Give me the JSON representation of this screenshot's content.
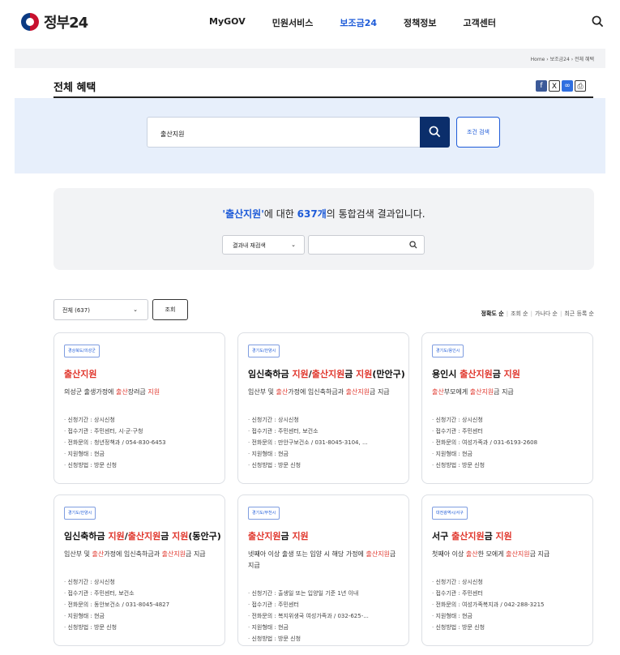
{
  "header": {
    "logo_text": "정부24",
    "nav": [
      "MyGOV",
      "민원서비스",
      "보조금24",
      "정책정보",
      "고객센터"
    ],
    "active_nav": "보조금24",
    "search_icon": "search-icon"
  },
  "breadcrumb": "Home  ›  보조금24  ›  전체 혜택",
  "page_title": "전체 혜택",
  "share_icons": [
    "facebook-icon",
    "x-icon",
    "link-icon",
    "print-icon"
  ],
  "search": {
    "query": "출산지원",
    "button_icon": "search-icon",
    "condition_button": "조건 검색"
  },
  "result": {
    "keyword": "'출산지원'",
    "count": "637개",
    "text_mid": "에 대한 ",
    "text_end": "의 통합검색 결과입니다.",
    "within_label": "결과내 재검색",
    "within_placeholder": ""
  },
  "filter": {
    "selected": "전체 (637)",
    "query_button": "조회"
  },
  "sort": [
    "정확도 순",
    "조회 순",
    "가나다 순",
    "최근 등록 순"
  ],
  "sort_active": "정확도 순",
  "cards": [
    {
      "tag": "경상북도/의성군",
      "title_parts": [
        {
          "t": "출산지원",
          "r": true
        }
      ],
      "desc_parts": [
        {
          "t": "의성군 출생가정에 ",
          "r": false
        },
        {
          "t": "출산",
          "r": true
        },
        {
          "t": "장려금 ",
          "r": false
        },
        {
          "t": "지원",
          "r": true
        }
      ],
      "items": [
        "신청기간 : 상시신청",
        "접수기관 : 주민센터, 시·군·구청",
        "전화문의 : 청년정책과 / 054-830-6453",
        "지원형태 : 현금",
        "신청방법 : 방문 신청"
      ]
    },
    {
      "tag": "경기도/안양시",
      "title_parts": [
        {
          "t": "임신축하금 ",
          "r": false
        },
        {
          "t": "지원",
          "r": true
        },
        {
          "t": "/",
          "r": false
        },
        {
          "t": "출산지원",
          "r": true
        },
        {
          "t": "금 ",
          "r": false
        },
        {
          "t": "지원",
          "r": true
        },
        {
          "t": "(만안구)",
          "r": false
        }
      ],
      "desc_parts": [
        {
          "t": "임산부 및 ",
          "r": false
        },
        {
          "t": "출산",
          "r": true
        },
        {
          "t": "가정에 임신축하금과 ",
          "r": false
        },
        {
          "t": "출산지원",
          "r": true
        },
        {
          "t": "금 지급",
          "r": false
        }
      ],
      "items": [
        "신청기간 : 상시신청",
        "접수기관 : 주민센터, 보건소",
        "전화문의 : 만안구보건소 / 031-8045-3104, ...",
        "지원형태 : 현금",
        "신청방법 : 방문 신청"
      ]
    },
    {
      "tag": "경기도/용인시",
      "title_parts": [
        {
          "t": "용인시 ",
          "r": false
        },
        {
          "t": "출산지원",
          "r": true
        },
        {
          "t": "금 ",
          "r": false
        },
        {
          "t": "지원",
          "r": true
        }
      ],
      "desc_parts": [
        {
          "t": "출산",
          "r": true
        },
        {
          "t": "부모에게 ",
          "r": false
        },
        {
          "t": "출산지원",
          "r": true
        },
        {
          "t": "금 지급",
          "r": false
        }
      ],
      "items": [
        "신청기간 : 상시신청",
        "접수기관 : 주민센터",
        "전화문의 : 여성가족과 / 031-6193-2608",
        "지원형태 : 현금",
        "신청방법 : 방문 신청"
      ]
    },
    {
      "tag": "경기도/안양시",
      "title_parts": [
        {
          "t": "임신축하금 ",
          "r": false
        },
        {
          "t": "지원",
          "r": true
        },
        {
          "t": "/",
          "r": false
        },
        {
          "t": "출산지원",
          "r": true
        },
        {
          "t": "금 ",
          "r": false
        },
        {
          "t": "지원",
          "r": true
        },
        {
          "t": "(동안구)",
          "r": false
        }
      ],
      "desc_parts": [
        {
          "t": "임산부 및 ",
          "r": false
        },
        {
          "t": "출산",
          "r": true
        },
        {
          "t": "가정에 임신축하금과 ",
          "r": false
        },
        {
          "t": "출산지원",
          "r": true
        },
        {
          "t": "금 지급",
          "r": false
        }
      ],
      "items": [
        "신청기간 : 상시신청",
        "접수기관 : 주민센터, 보건소",
        "전화문의 : 동안보건소 / 031-8045-4827",
        "지원형태 : 현금",
        "신청방법 : 방문 신청"
      ]
    },
    {
      "tag": "경기도/부천시",
      "title_parts": [
        {
          "t": "출산지원",
          "r": true
        },
        {
          "t": "금 ",
          "r": false
        },
        {
          "t": "지원",
          "r": true
        }
      ],
      "desc_parts": [
        {
          "t": "넷째아 이상 출생 또는 입양 시 해당 가정에 ",
          "r": false
        },
        {
          "t": "출산지원",
          "r": true
        },
        {
          "t": "금 지급",
          "r": false
        }
      ],
      "items": [
        "신청기간 : 출생일 또는 입양일 기준 1년 이내",
        "접수기관 : 주민센터",
        "전화문의 : 복지위생국 여성가족과 / 032-625-...",
        "지원형태 : 현금",
        "신청방법 : 방문 신청"
      ]
    },
    {
      "tag": "대전광역시/서구",
      "title_parts": [
        {
          "t": "서구 ",
          "r": false
        },
        {
          "t": "출산지원",
          "r": true
        },
        {
          "t": "금 ",
          "r": false
        },
        {
          "t": "지원",
          "r": true
        }
      ],
      "desc_parts": [
        {
          "t": "첫째아 이상 ",
          "r": false
        },
        {
          "t": "출산",
          "r": true
        },
        {
          "t": "한 모에게 ",
          "r": false
        },
        {
          "t": "출산지원",
          "r": true
        },
        {
          "t": "금 지급",
          "r": false
        }
      ],
      "items": [
        "신청기간 : 상시신청",
        "접수기관 : 주민센터",
        "전화문의 : 여성가족복지과 / 042-288-3215",
        "지원형태 : 현금",
        "신청방법 : 방문 신청"
      ]
    }
  ],
  "colors": {
    "accent": "#1e5bd8",
    "highlight": "#e0352b",
    "search_button": "#0b2e6b",
    "band": "#e7effb"
  }
}
